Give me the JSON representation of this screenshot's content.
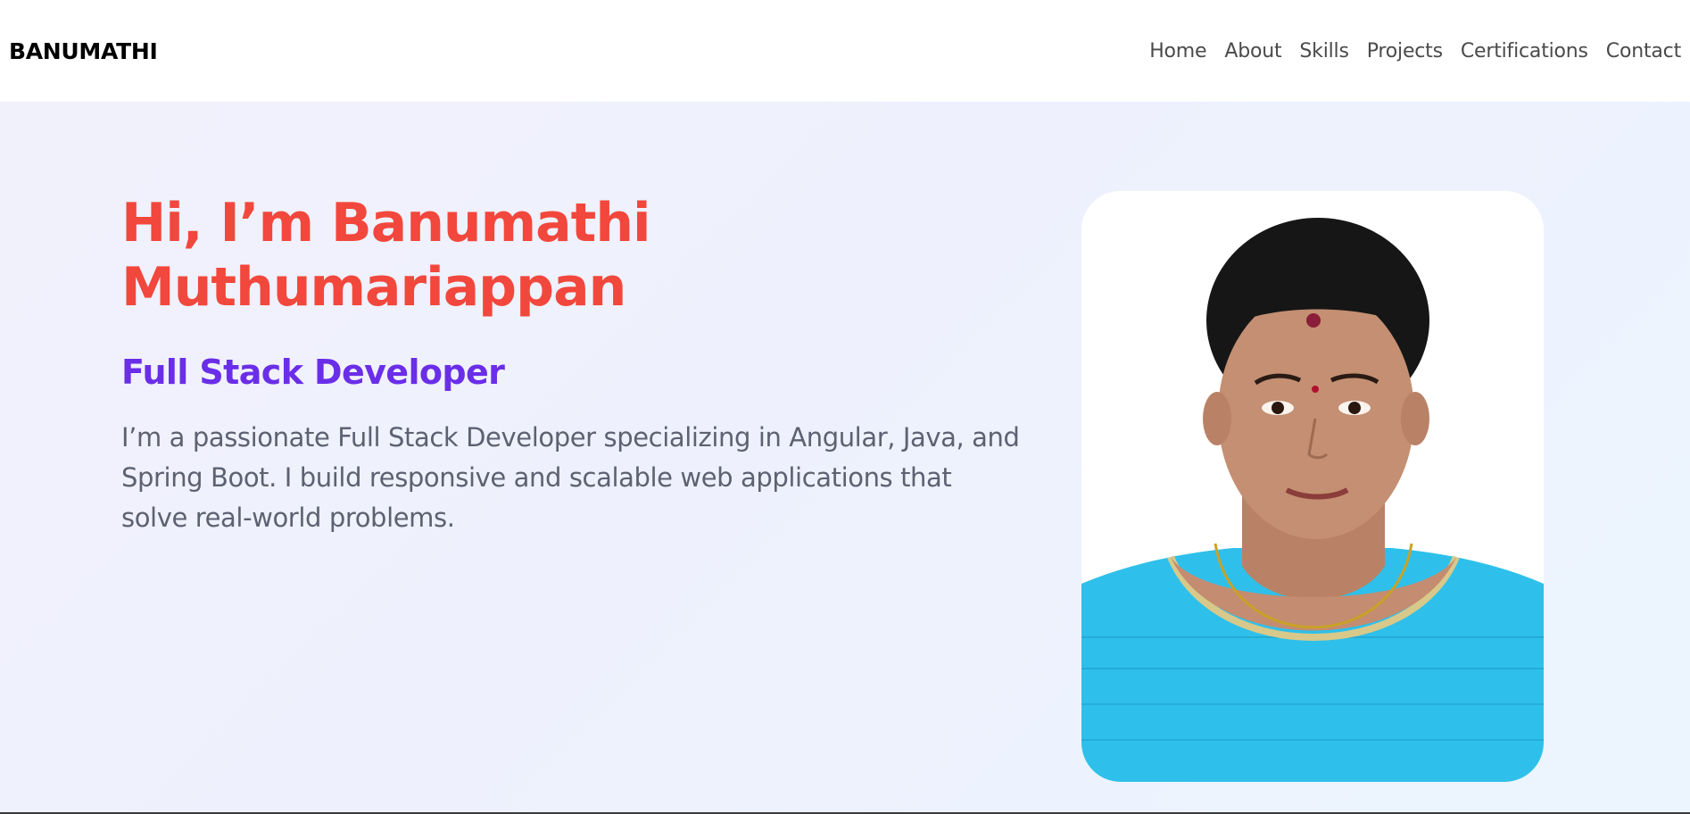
{
  "navbar": {
    "brand": "BANUMATHI",
    "links": [
      {
        "label": "Home"
      },
      {
        "label": "About"
      },
      {
        "label": "Skills"
      },
      {
        "label": "Projects"
      },
      {
        "label": "Certifications"
      },
      {
        "label": "Contact"
      }
    ]
  },
  "hero": {
    "title_line1": "Hi, I’m Banumathi",
    "title_line2": "Muthumariappan",
    "role": "Full Stack Developer",
    "description": "I’m a passionate Full Stack Developer specializing in Angular, Java, and Spring Boot. I build responsive and scalable web applications that solve real-world problems."
  },
  "colors": {
    "title": "#f2473c",
    "role": "#6a2ee8",
    "description": "#5d6171",
    "nav_text": "#4a4a4a",
    "hero_bg": "#eef1fd"
  },
  "icons": {
    "profile_photo": "portrait-photo"
  }
}
